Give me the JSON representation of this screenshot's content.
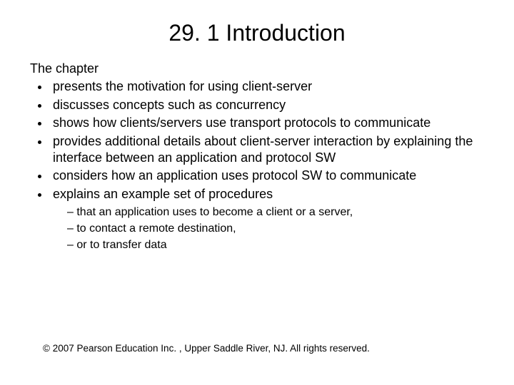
{
  "title": "29. 1 Introduction",
  "intro": "The chapter",
  "bullets": [
    "presents the motivation for using client-server",
    "discusses concepts such as concurrency",
    "shows how clients/servers use transport protocols to communicate",
    "provides additional details about client-server interaction by explaining the interface between an application and protocol SW",
    "considers how an application uses protocol SW to communicate",
    "explains an example set of procedures"
  ],
  "subbullets": [
    "that an application uses to become a client or a server,",
    "to contact a remote destination,",
    "or to transfer data"
  ],
  "footer": "© 2007 Pearson Education Inc. , Upper Saddle River, NJ. All rights reserved."
}
